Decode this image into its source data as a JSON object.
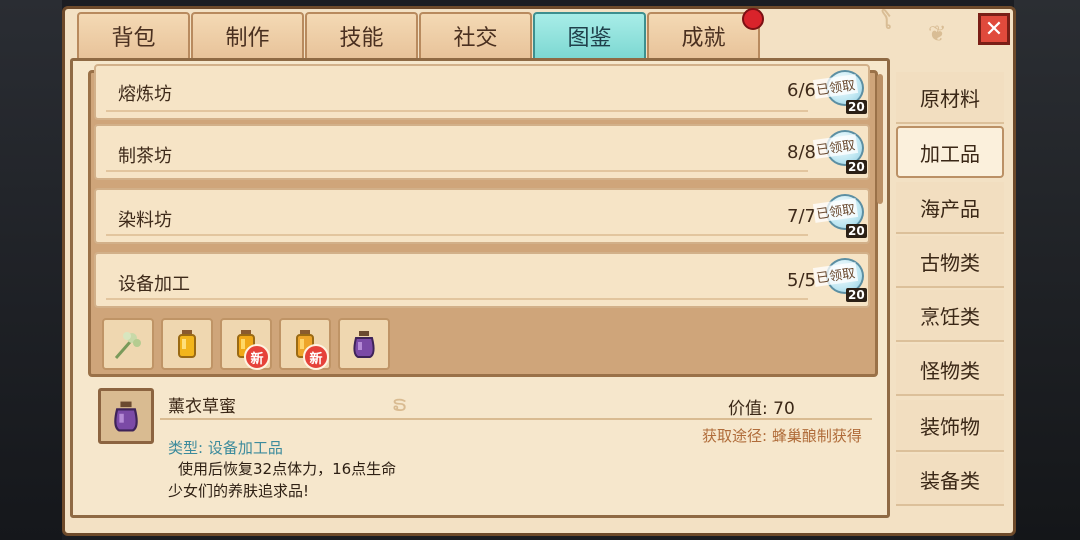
{
  "tabs": [
    {
      "label": "背包",
      "active": false
    },
    {
      "label": "制作",
      "active": false
    },
    {
      "label": "技能",
      "active": false
    },
    {
      "label": "社交",
      "active": false
    },
    {
      "label": "图鉴",
      "active": true
    },
    {
      "label": "成就",
      "active": false
    }
  ],
  "close_label": "✕",
  "workshops": [
    {
      "name": "熔炼坊",
      "count": "6/6",
      "badge": "已领取",
      "reward": "20"
    },
    {
      "name": "制茶坊",
      "count": "8/8",
      "badge": "已领取",
      "reward": "20"
    },
    {
      "name": "染料坊",
      "count": "7/7",
      "badge": "已领取",
      "reward": "20"
    },
    {
      "name": "设备加工",
      "count": "5/5",
      "badge": "已领取",
      "reward": "20"
    }
  ],
  "items": [
    {
      "icon": "herb-sprig-icon",
      "is_new": false
    },
    {
      "icon": "honey-jar-icon",
      "is_new": false
    },
    {
      "icon": "honey-jar-icon",
      "is_new": true,
      "new_label": "新"
    },
    {
      "icon": "honey-jar-icon",
      "is_new": true,
      "new_label": "新"
    },
    {
      "icon": "purple-pot-icon",
      "is_new": false
    }
  ],
  "detail": {
    "icon": "purple-pot-icon",
    "name": "薰衣草蜜",
    "value": "价值: 70",
    "source": "获取途径: 蜂巢酿制获得",
    "type": "类型: 设备加工品",
    "effect": "使用后恢复32点体力，16点生命",
    "desc": "少女们的养肤追求品!"
  },
  "categories": [
    {
      "label": "原材料",
      "active": false
    },
    {
      "label": "加工品",
      "active": true
    },
    {
      "label": "海产品",
      "active": false
    },
    {
      "label": "古物类",
      "active": false
    },
    {
      "label": "烹饪类",
      "active": false
    },
    {
      "label": "怪物类",
      "active": false
    },
    {
      "label": "装饰物",
      "active": false
    },
    {
      "label": "装备类",
      "active": false
    }
  ],
  "colors": {
    "panel": "#f3e1c4",
    "active_tab": "#7dd8d2",
    "new_badge": "#e6423a",
    "accent_text": "#3c8b9c"
  }
}
